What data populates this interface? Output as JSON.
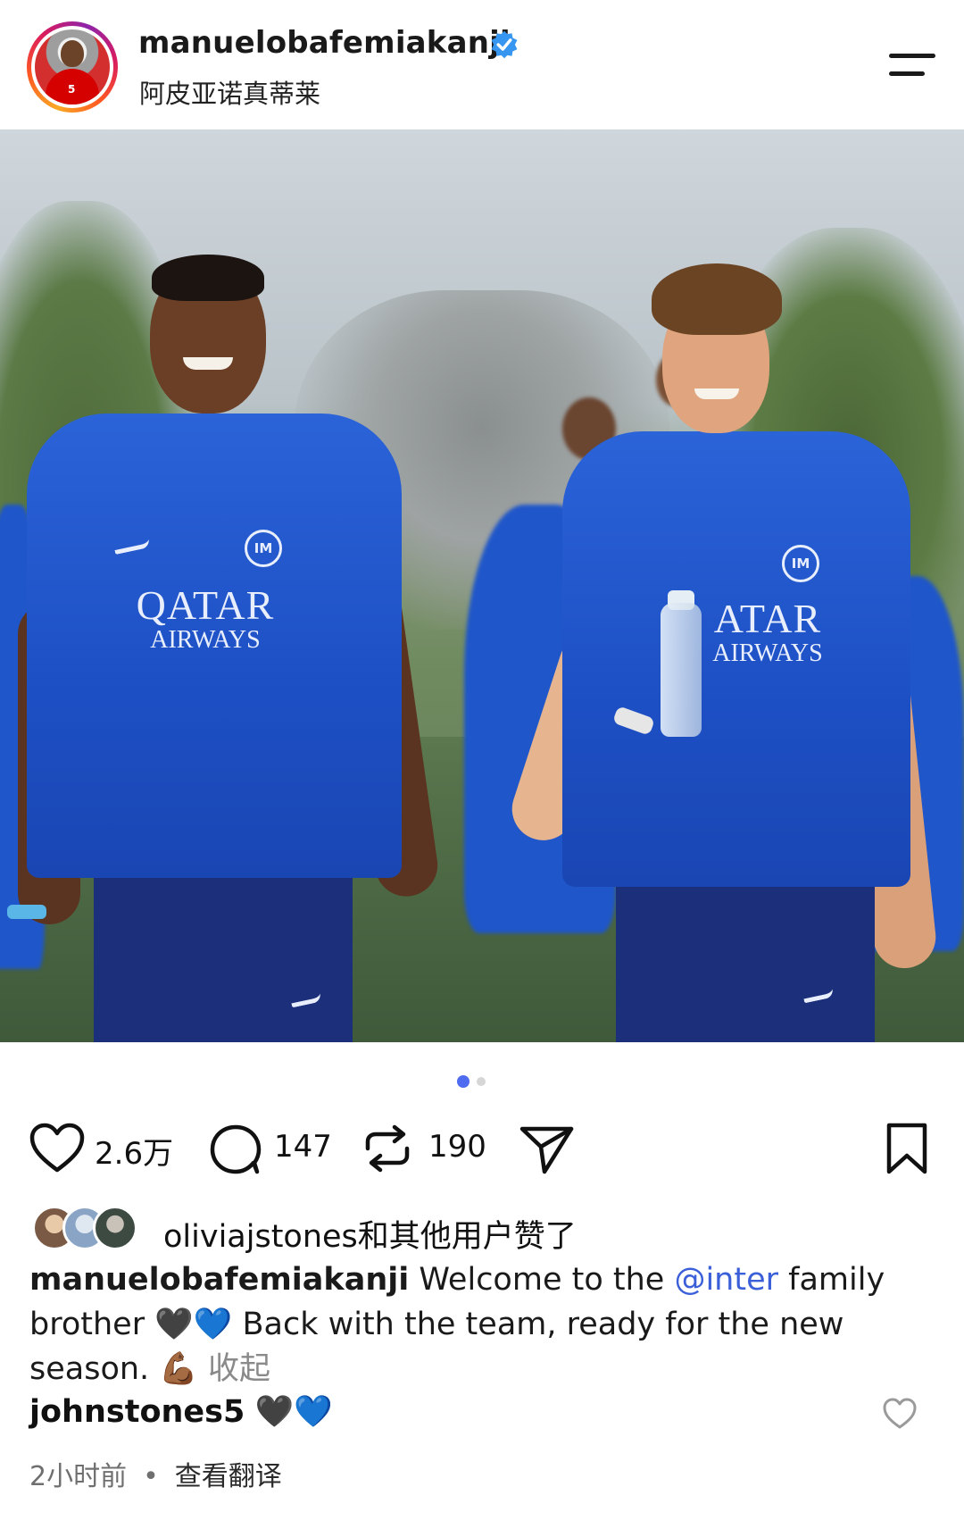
{
  "header": {
    "username": "manuelobafemiakanji",
    "subtitle": "阿皮亚诺真蒂莱",
    "avatar_number": "5"
  },
  "photo": {
    "sponsor_line1": "QATAR",
    "sponsor_line2": "AIRWAYS",
    "crest_text": "IM",
    "sponsor2_line1": "ATAR",
    "sponsor2_line2": "AIRWAYS"
  },
  "carousel": {
    "current": 1,
    "total": 2
  },
  "actions": {
    "like_count": "2.6万",
    "comment_count": "147",
    "repost_count": "190"
  },
  "likes": {
    "text": "oliviajstones和其他用户赞了"
  },
  "caption": {
    "username": "manuelobafemiakanji",
    "text_before": "Welcome to the ",
    "mention": "@inter",
    "text_after": " family brother ",
    "hearts": "🖤💙",
    "text_end": " Back with the team, ready for the new season. 💪🏾 ",
    "collapse": "收起"
  },
  "comment": {
    "username": "johnstones5",
    "text": "🖤💙"
  },
  "meta": {
    "time": "2小时前",
    "dot": "•",
    "translate": "查看翻译"
  },
  "colors": {
    "accent": "#4f6bf0",
    "mention": "#3a5fd9",
    "verified": "#3797f0",
    "jersey": "#1d4fc4"
  }
}
